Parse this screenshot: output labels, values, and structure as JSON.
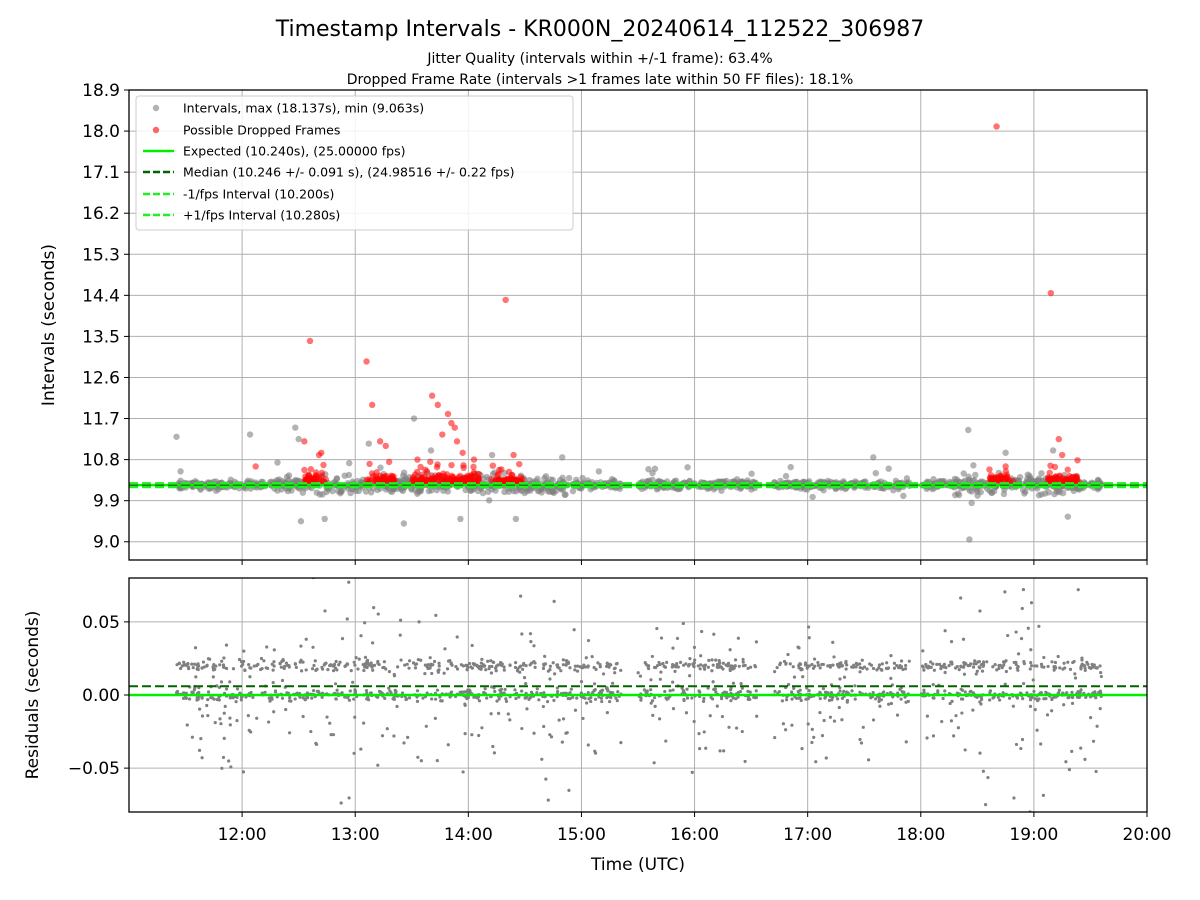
{
  "chart_data": [
    {
      "type": "scatter",
      "title": "Timestamp Intervals - KR000N_20240614_112522_306987",
      "subtitle_1": "Jitter Quality (intervals within +/-1 frame): 63.4%",
      "subtitle_2": "Dropped Frame Rate (intervals >1 frames late within 50 FF files): 18.1%",
      "xlabel": "",
      "ylabel": "Intervals (seconds)",
      "xlim_hours": [
        11.0,
        20.0
      ],
      "ylim": [
        8.6,
        18.9
      ],
      "y_ticks": [
        9.0,
        9.9,
        10.8,
        11.7,
        12.6,
        13.5,
        14.4,
        15.3,
        16.2,
        17.1,
        18.0,
        18.9
      ],
      "y_tick_labels": [
        "9.0",
        "9.9",
        "10.8",
        "11.7",
        "12.6",
        "13.5",
        "14.4",
        "15.3",
        "16.2",
        "17.1",
        "18.0",
        "18.9"
      ],
      "grid": true,
      "legend_position": "upper-left",
      "legend": [
        "Intervals, max (18.137s), min (9.063s)",
        "Possible Dropped Frames",
        "Expected (10.240s), (25.00000 fps)",
        "Median (10.246 +/- 0.091 s), (24.98516 +/- 0.22 fps)",
        "-1/fps Interval (10.200s)",
        "+1/fps Interval (10.280s)"
      ],
      "reference_lines": {
        "expected": 10.24,
        "median": 10.246,
        "minus_one_fps": 10.2,
        "plus_one_fps": 10.28
      },
      "colors": {
        "intervals": "#808080",
        "dropped": "#ff0000",
        "expected": "#00ee00",
        "median": "#006400",
        "fps_bounds": "#22ee22"
      },
      "series": [
        {
          "name": "Intervals, max (18.137s), min (9.063s)",
          "x": [
            11.42,
            12.07,
            12.47,
            12.5,
            13.12,
            13.52,
            13.67,
            14.21,
            14.83,
            15.65,
            17.58,
            18.42,
            18.43,
            18.75,
            19.17,
            12.52,
            12.73,
            13.43,
            13.93,
            14.42,
            18.45,
            19.3
          ],
          "y": [
            11.3,
            11.35,
            11.5,
            11.25,
            11.15,
            11.7,
            11.0,
            10.9,
            10.85,
            10.6,
            10.85,
            11.45,
            9.05,
            10.95,
            11.0,
            9.45,
            9.5,
            9.4,
            9.5,
            9.5,
            9.85,
            9.55
          ]
        },
        {
          "name": "Possible Dropped Frames",
          "x": [
            12.12,
            12.55,
            12.6,
            12.68,
            12.7,
            13.1,
            13.15,
            13.22,
            13.27,
            13.3,
            13.55,
            13.68,
            13.73,
            13.77,
            13.82,
            13.85,
            13.88,
            13.9,
            13.95,
            14.05,
            14.33,
            14.4,
            14.45,
            18.67,
            18.75,
            19.15,
            19.22,
            19.25
          ],
          "y": [
            10.65,
            11.2,
            13.4,
            10.9,
            10.95,
            12.95,
            12.0,
            11.2,
            11.1,
            10.75,
            10.8,
            12.2,
            12.0,
            11.35,
            11.8,
            11.6,
            11.5,
            11.2,
            10.95,
            10.8,
            14.3,
            10.9,
            10.7,
            18.1,
            10.65,
            14.45,
            11.25,
            10.9
          ]
        }
      ]
    },
    {
      "type": "scatter",
      "xlabel": "Time (UTC)",
      "ylabel": "Residuals (seconds)",
      "xlim_hours": [
        11.0,
        20.0
      ],
      "ylim": [
        -0.08,
        0.08
      ],
      "x_ticks_hours": [
        12,
        13,
        14,
        15,
        16,
        17,
        18,
        19,
        20
      ],
      "x_tick_labels": [
        "12:00",
        "13:00",
        "14:00",
        "15:00",
        "16:00",
        "17:00",
        "18:00",
        "19:00",
        "20:00"
      ],
      "y_ticks": [
        -0.05,
        0.0,
        0.05
      ],
      "y_tick_labels": [
        "−0.05",
        "0.00",
        "0.05"
      ],
      "grid": true,
      "reference_lines": {
        "expected_residual": 0.0,
        "median_residual": 0.006
      },
      "colors": {
        "points": "#808080",
        "expected": "#00ee00",
        "median": "#006400"
      },
      "coverage_hours": [
        11.42,
        19.6
      ],
      "gap_hours": [
        [
          15.35,
          15.5
        ],
        [
          16.55,
          16.7
        ],
        [
          17.9,
          18.0
        ]
      ]
    }
  ]
}
